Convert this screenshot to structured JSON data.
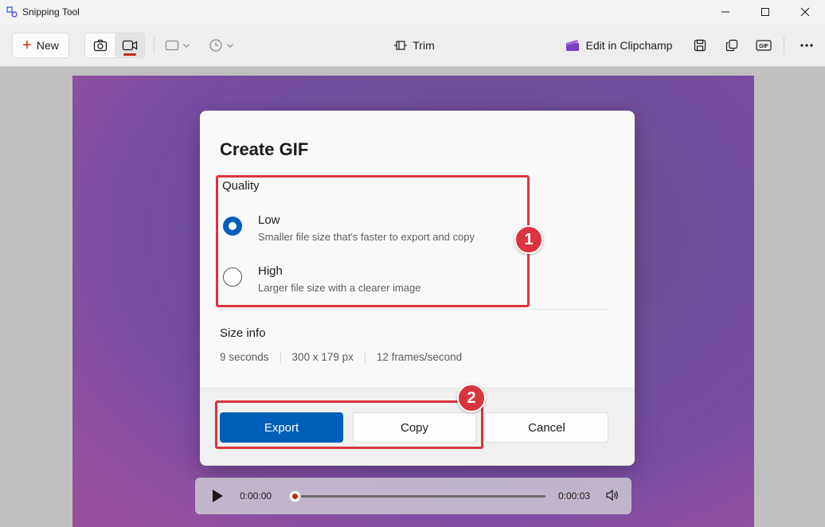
{
  "window": {
    "title": "Snipping Tool",
    "controls": [
      "minimize",
      "maximize",
      "close"
    ]
  },
  "toolbar": {
    "new_label": "New",
    "trim_label": "Trim",
    "clipchamp_label": "Edit in Clipchamp",
    "icons": [
      "camera-icon",
      "video-icon",
      "snip-shape-icon",
      "timer-icon",
      "save-icon",
      "copy-icon",
      "gif-icon",
      "more-icon"
    ],
    "gif_badge": "GIF"
  },
  "dialog": {
    "title": "Create GIF",
    "quality": {
      "label": "Quality",
      "options": [
        {
          "title": "Low",
          "subtitle": "Smaller file size that's faster to export and copy",
          "selected": true
        },
        {
          "title": "High",
          "subtitle": "Larger file size with a clearer image",
          "selected": false
        }
      ]
    },
    "size_info": {
      "label": "Size info",
      "items": [
        "9 seconds",
        "300 x 179 px",
        "12 frames/second"
      ]
    },
    "buttons": {
      "export": "Export",
      "copy": "Copy",
      "cancel": "Cancel"
    }
  },
  "annotations": {
    "badge1": "1",
    "badge2": "2",
    "color": "#d9343f"
  },
  "playback": {
    "current": "0:00:00",
    "total": "0:00:03"
  },
  "colors": {
    "accent": "#005fb8",
    "record_red": "#c42b1c"
  }
}
